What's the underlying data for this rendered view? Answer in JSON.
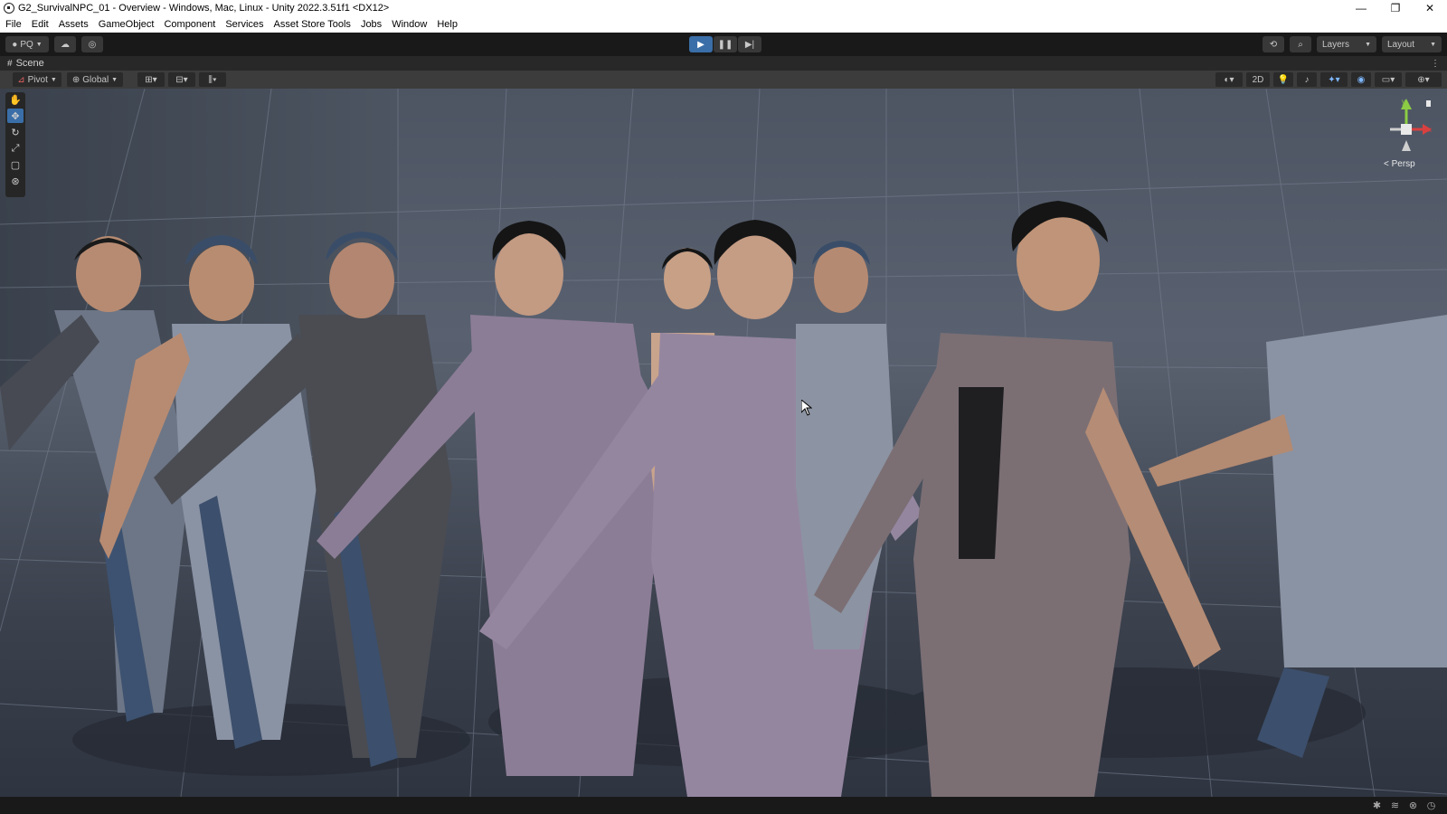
{
  "window": {
    "title": "G2_SurvivalNPC_01 - Overview - Windows, Mac, Linux - Unity 2022.3.51f1 <DX12>",
    "minimize": "—",
    "maximize": "❐",
    "close": "✕"
  },
  "menu": [
    "File",
    "Edit",
    "Assets",
    "GameObject",
    "Component",
    "Services",
    "Asset Store Tools",
    "Jobs",
    "Window",
    "Help"
  ],
  "toolbar": {
    "account_label": "PQ",
    "layers_label": "Layers",
    "layout_label": "Layout"
  },
  "scene": {
    "tab_label": "Scene",
    "pivot_label": "Pivot",
    "global_label": "Global",
    "mode_2d_label": "2D",
    "persp_label": "< Persp",
    "gizmo_y": "y",
    "gizmo_x": "x"
  },
  "colors": {
    "play_active": "#3a6ea8",
    "panel_dark": "#191919",
    "scene_toolbar": "#3c3c3c",
    "gizmo_green": "#8ccc44",
    "gizmo_red": "#d84040"
  },
  "icons": {
    "tools": [
      "hand-tool-icon",
      "move-tool-icon",
      "rotate-tool-icon",
      "scale-tool-icon",
      "rect-tool-icon",
      "transform-tool-icon"
    ],
    "status": [
      "bug-icon",
      "layers-icon",
      "debug-icon",
      "account-icon"
    ]
  }
}
